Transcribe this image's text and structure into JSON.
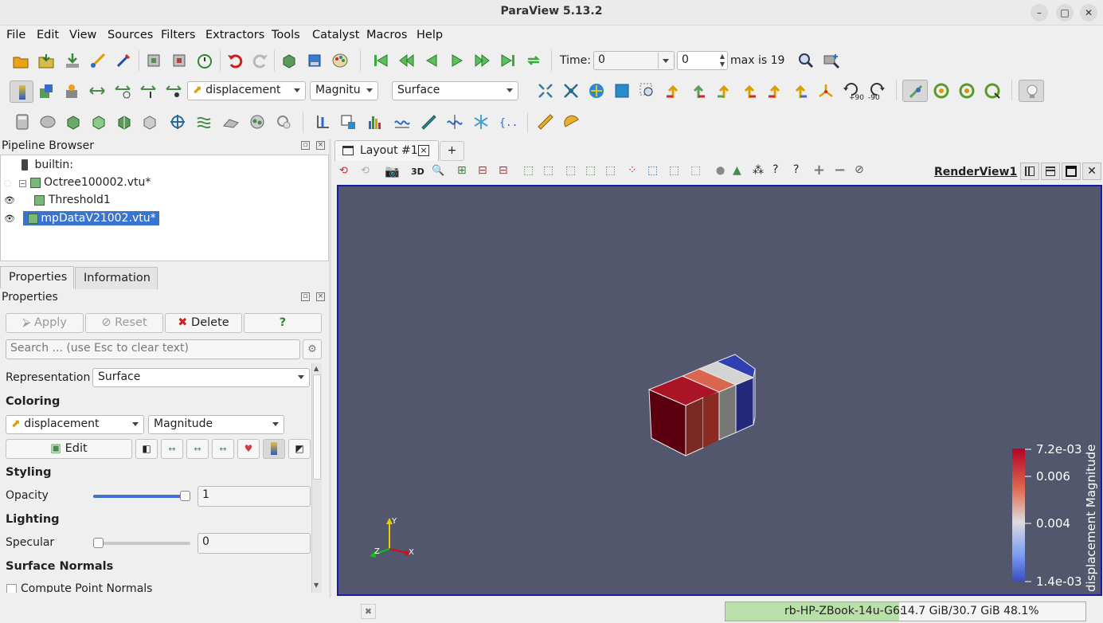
{
  "window": {
    "title": "ParaView 5.13.2",
    "min": "–",
    "max": "□",
    "close": "✕"
  },
  "menu": [
    "File",
    "Edit",
    "View",
    "Sources",
    "Filters",
    "Extractors",
    "Tools",
    "Catalyst",
    "Macros",
    "Help"
  ],
  "time_toolbar": {
    "time_label": "Time:",
    "time_value": "0",
    "step_value": "0",
    "max_text": "max is 19"
  },
  "color_toolbar": {
    "array": "displacement",
    "component": "Magnitu",
    "representation": "Surface"
  },
  "camera_labels": {
    "plus90": "+90",
    "minus90": "-90"
  },
  "pipeline": {
    "title": "Pipeline Browser",
    "items": [
      {
        "label": "builtin:"
      },
      {
        "label": "Octree100002.vtu*"
      },
      {
        "label": "Threshold1"
      },
      {
        "label": "mpDataV21002.vtu*"
      }
    ]
  },
  "layout_tab": {
    "label": "Layout #1",
    "add": "+"
  },
  "render_view": {
    "name": "RenderView1",
    "toggle_3d": "3D"
  },
  "properties": {
    "tabs": [
      "Properties",
      "Information"
    ],
    "title": "Properties",
    "buttons": {
      "apply": "Apply",
      "reset": "Reset",
      "delete": "Delete",
      "help": "?"
    },
    "search_placeholder": "Search ... (use Esc to clear text)",
    "representation_label": "Representation",
    "representation_value": "Surface",
    "coloring_header": "Coloring",
    "coloring_array": "displacement",
    "coloring_component": "Magnitude",
    "edit_label": "Edit",
    "styling_header": "Styling",
    "opacity_label": "Opacity",
    "opacity_value": "1",
    "opacity_level": 1.0,
    "lighting_header": "Lighting",
    "specular_label": "Specular",
    "specular_value": "0",
    "specular_level": 0.0,
    "surface_normals_header": "Surface Normals",
    "compute_normals_label": "Compute Point Normals"
  },
  "legend": {
    "title": "displacement Magnitude",
    "ticks": [
      "7.2e-03",
      "0.006",
      "0.004",
      "1.4e-03"
    ]
  },
  "axes": {
    "y": "Y",
    "x": "X",
    "z": "Z"
  },
  "status": {
    "host": "rb-HP-ZBook-14u-G6:",
    "memory": "14.7 GiB/30.7 GiB 48.1%",
    "memory_fraction": 0.481
  },
  "colors": {
    "background": "#52576e",
    "selection": "#3874d0",
    "accent": "#1a1aa8"
  }
}
